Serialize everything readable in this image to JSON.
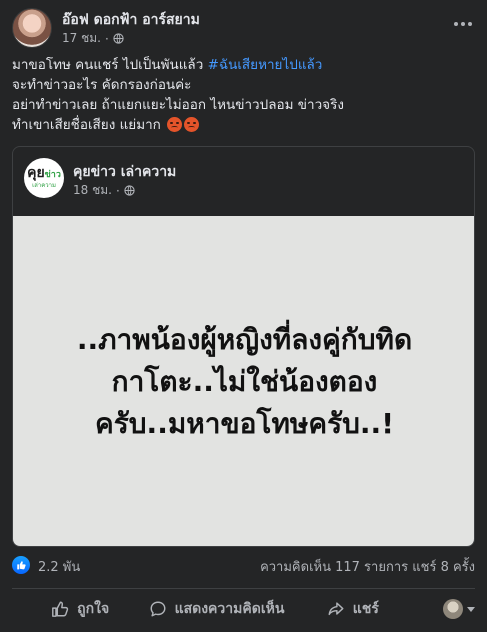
{
  "post": {
    "author": "อ๊อฟ ดอกฟ้า อาร์สยาม",
    "time": "17 ชม.",
    "text_lines": [
      {
        "text": "มาขอโทษ คนแชร์ ไปเป็นพันแล้ว ",
        "hashtag": "#ฉันเสียหายไปแล้ว"
      },
      {
        "text": "จะทำข่าวอะไร คัดกรองก่อนค่ะ"
      },
      {
        "text": "อย่าทำข่าวเลย ถ้าแยกแยะไม่ออก ไหนข่าวปลอม ข่าวจริง"
      },
      {
        "text": "ทำเขาเสียชื่อเสียง แย่มาก"
      }
    ],
    "emojis": [
      "angry-face",
      "angry-face"
    ]
  },
  "shared": {
    "page_name": "คุยข่าว เล่าความ",
    "time": "18 ชม.",
    "logo_text": {
      "main": "คุย",
      "accent": "ข่าว",
      "sub": "เล่าความ"
    },
    "image_text_lines": [
      "..ภาพน้องผู้หญิงที่ลงคู่กับทิด",
      "กาโตะ..ไม่ใช่น้องตอง",
      "ครับ..มหาขอโทษครับ..!"
    ]
  },
  "stats": {
    "reactions": "2.2 พัน",
    "comments": "ความคิดเห็น 117 รายการ",
    "shares": "แชร์ 8 ครั้ง"
  },
  "actions": {
    "like": "ถูกใจ",
    "comment": "แสดงความคิดเห็น",
    "share": "แชร์"
  },
  "colors": {
    "background": "#242526",
    "text": "#e4e6eb",
    "secondary_text": "#b0b3b8",
    "hashtag": "#4599ff",
    "like_blue": "#0866ff"
  }
}
